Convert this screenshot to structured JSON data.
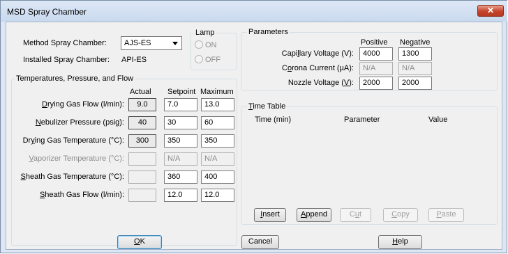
{
  "window": {
    "title": "MSD Spray Chamber",
    "close_glyph": "✕"
  },
  "method": {
    "method_label": "Method Spray Chamber:",
    "method_value": "AJS-ES",
    "installed_label": "Installed Spray Chamber:",
    "installed_value": "API-ES"
  },
  "lamp": {
    "title": "Lamp",
    "on_label": "ON",
    "off_label": "OFF"
  },
  "temps": {
    "title": "Temperatures, Pressure, and Flow",
    "col_actual": "Actual",
    "col_setpoint": "Setpoint",
    "col_maximum": "Maximum",
    "rows": [
      {
        "label_pre": "",
        "label_key": "D",
        "label_post": "rying Gas Flow (l/min):",
        "actual": "9.0",
        "setpoint": "7.0",
        "maximum": "13.0"
      },
      {
        "label_pre": "",
        "label_key": "N",
        "label_post": "ebulizer Pressure (psig):",
        "actual": "40",
        "setpoint": "30",
        "maximum": "60"
      },
      {
        "label_pre": "Dr",
        "label_key": "y",
        "label_post": "ing Gas Temperature (°C):",
        "actual": "300",
        "setpoint": "350",
        "maximum": "350"
      },
      {
        "label_pre": "",
        "label_key": "V",
        "label_post": "aporizer Temperature (°C):",
        "actual": "",
        "setpoint": "N/A",
        "maximum": "N/A"
      },
      {
        "label_pre": "",
        "label_key": "S",
        "label_post": "heath Gas  Temperature (°C):",
        "actual": "",
        "setpoint": "360",
        "maximum": "400"
      },
      {
        "label_pre": "",
        "label_key": "S",
        "label_post": "heath Gas Flow (l/min):",
        "actual": "",
        "setpoint": "12.0",
        "maximum": "12.0"
      }
    ]
  },
  "params": {
    "title": "Parameters",
    "col_positive": "Positive",
    "col_negative": "Negative",
    "rows": [
      {
        "label_pre": "Capi",
        "label_key": "l",
        "label_post": "lary Voltage (V):",
        "positive": "4000",
        "negative": "1300"
      },
      {
        "label_pre": "C",
        "label_key": "o",
        "label_post": "rona Current (µA):",
        "positive": "N/A",
        "negative": "N/A"
      },
      {
        "label_pre": "Nozzle Voltage (",
        "label_key": "V",
        "label_post": "):",
        "positive": "2000",
        "negative": "2000"
      }
    ]
  },
  "timetable": {
    "title_key": "T",
    "title_rest": "ime Table",
    "col_time": "Time (min)",
    "col_parameter": "Parameter",
    "col_value": "Value",
    "insert_key": "I",
    "insert_rest": "nsert",
    "append_key": "A",
    "append_rest": "ppend",
    "cut_pre": "C",
    "cut_key": "u",
    "cut_post": "t",
    "copy_key": "C",
    "copy_rest": "opy",
    "paste_key": "P",
    "paste_rest": "aste"
  },
  "footer": {
    "ok_key": "O",
    "ok_rest": "K",
    "cancel_label": "Cancel",
    "help_key": "H",
    "help_rest": "elp"
  }
}
